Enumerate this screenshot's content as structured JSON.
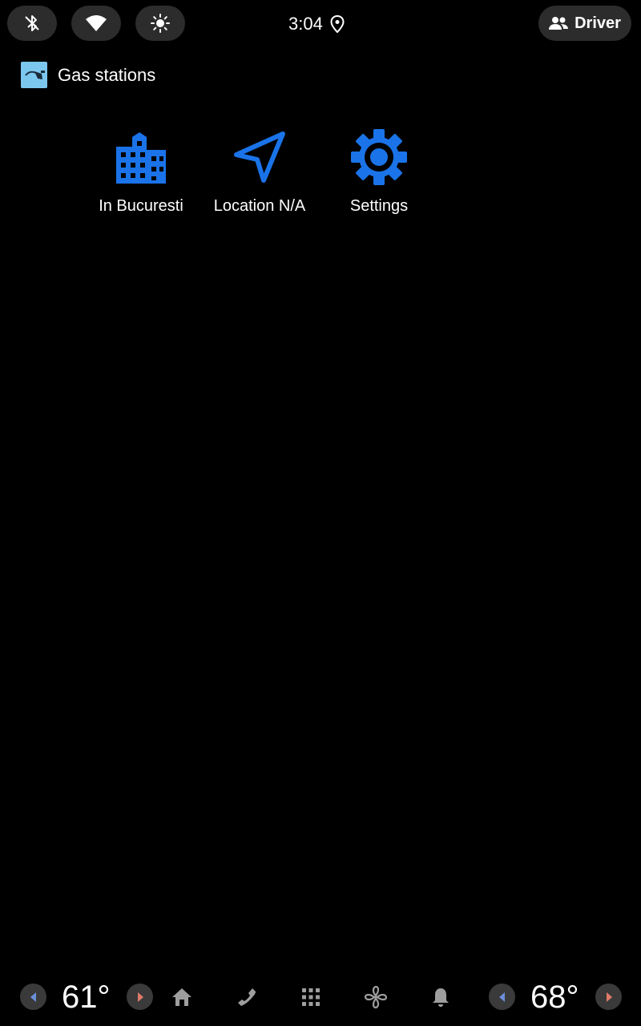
{
  "status_bar": {
    "time": "3:04",
    "user_label": "Driver",
    "icons": [
      "bluetooth-icon",
      "wifi-icon",
      "brightness-icon",
      "location-pin-icon",
      "people-icon"
    ]
  },
  "app": {
    "title": "Gas stations",
    "icon": "fuel-nozzle-icon"
  },
  "actions": [
    {
      "label": "In Bucuresti",
      "icon": "city-buildings-icon"
    },
    {
      "label": "Location N/A",
      "icon": "navigation-arrow-icon"
    },
    {
      "label": "Settings",
      "icon": "gear-icon"
    }
  ],
  "bottom_bar": {
    "left_temp": "61°",
    "right_temp": "68°",
    "nav_icons": [
      "home-icon",
      "phone-icon",
      "app-grid-icon",
      "fan-icon",
      "bell-icon"
    ]
  },
  "colors": {
    "accent": "#1a73e8",
    "background": "#000000",
    "pill": "#2c2c2c",
    "app_icon_bg": "#7cc7ee",
    "temp_down_arrow": "#6a8fd8",
    "temp_up_arrow": "#e07a6a"
  }
}
